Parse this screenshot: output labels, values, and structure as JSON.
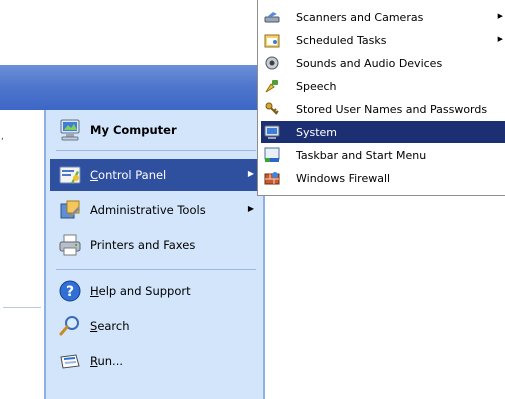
{
  "start_menu": {
    "left_mark": ",",
    "items": [
      {
        "label": "My Computer",
        "icon": "my-computer-icon",
        "bold": true
      },
      {
        "label": "Control Panel",
        "accel": "C",
        "icon": "control-panel-icon",
        "submenu": true,
        "active": true
      },
      {
        "label": "Administrative Tools",
        "icon": "administrative-tools-icon",
        "submenu": true
      },
      {
        "label": "Printers and Faxes",
        "icon": "printers-faxes-icon"
      },
      {
        "label": "Help and Support",
        "accel": "H",
        "icon": "help-icon"
      },
      {
        "label": "Search",
        "accel": "S",
        "icon": "search-icon"
      },
      {
        "label": "Run...",
        "accel": "R",
        "icon": "run-icon"
      }
    ]
  },
  "flyout": {
    "items": [
      {
        "label": "Scanners and Cameras",
        "icon": "scanner-camera-icon",
        "submenu": true
      },
      {
        "label": "Scheduled Tasks",
        "icon": "scheduled-tasks-icon",
        "submenu": true
      },
      {
        "label": "Sounds and Audio Devices",
        "icon": "sounds-icon"
      },
      {
        "label": "Speech",
        "icon": "speech-icon"
      },
      {
        "label": "Stored User Names and Passwords",
        "icon": "keys-icon"
      },
      {
        "label": "System",
        "icon": "system-icon",
        "active": true
      },
      {
        "label": "Taskbar and Start Menu",
        "icon": "taskbar-icon"
      },
      {
        "label": "Windows Firewall",
        "icon": "firewall-icon"
      }
    ]
  },
  "colors": {
    "header_blue": "#5077cd",
    "menu_pane": "#d3e5fa",
    "selected_left": "#2f4f9f",
    "selected_flyout": "#1c2f72"
  }
}
